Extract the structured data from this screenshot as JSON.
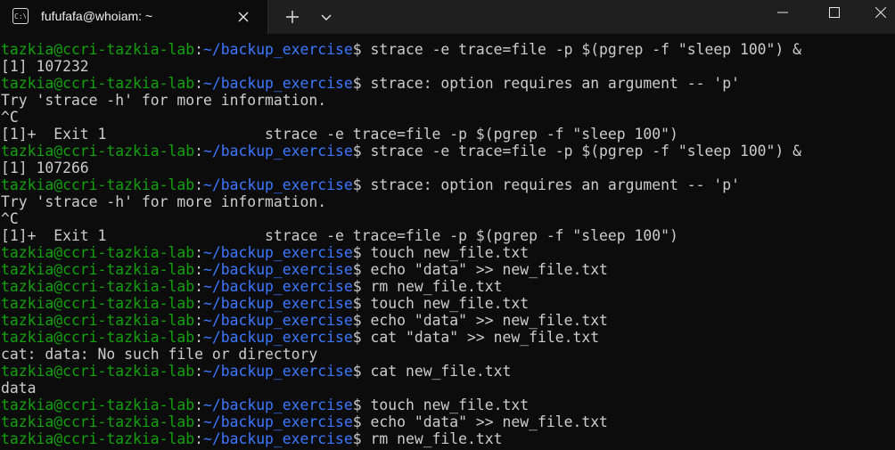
{
  "window": {
    "tab_title": "fufufafa@whoiam: ~",
    "icons": {
      "tab_icon": "terminal-icon",
      "close": "close-icon",
      "new_tab": "plus-icon",
      "dropdown": "chevron-down-icon",
      "minimize": "minimize-icon",
      "maximize": "maximize-icon",
      "close_window": "close-icon"
    }
  },
  "colors": {
    "background": "#0c0c0c",
    "prompt_user": "#13a10e",
    "prompt_path": "#3b78ff",
    "text": "#cccccc"
  },
  "terminal": {
    "prompt": {
      "user_host": "tazkia@ccri-tazkia-lab",
      "separator": ":",
      "path": "~/backup_exercise",
      "symbol": "$"
    },
    "lines": [
      {
        "type": "prompt",
        "cmd": " strace -e trace=file -p $(pgrep -f \"sleep 100\") &"
      },
      {
        "type": "output",
        "text": "[1] 107232"
      },
      {
        "type": "prompt",
        "cmd": " strace: option requires an argument -- 'p'"
      },
      {
        "type": "output",
        "text": "Try 'strace -h' for more information."
      },
      {
        "type": "output",
        "text": "^C"
      },
      {
        "type": "output",
        "text": "[1]+  Exit 1                  strace -e trace=file -p $(pgrep -f \"sleep 100\")"
      },
      {
        "type": "prompt",
        "cmd": " strace -e trace=file -p $(pgrep -f \"sleep 100\") &"
      },
      {
        "type": "output",
        "text": "[1] 107266"
      },
      {
        "type": "prompt",
        "cmd": " strace: option requires an argument -- 'p'"
      },
      {
        "type": "output",
        "text": "Try 'strace -h' for more information."
      },
      {
        "type": "output",
        "text": "^C"
      },
      {
        "type": "output",
        "text": "[1]+  Exit 1                  strace -e trace=file -p $(pgrep -f \"sleep 100\")"
      },
      {
        "type": "prompt",
        "cmd": " touch new_file.txt"
      },
      {
        "type": "prompt",
        "cmd": " echo \"data\" >> new_file.txt"
      },
      {
        "type": "prompt",
        "cmd": " rm new_file.txt"
      },
      {
        "type": "prompt",
        "cmd": " touch new_file.txt"
      },
      {
        "type": "prompt",
        "cmd": " echo \"data\" >> new_file.txt"
      },
      {
        "type": "prompt",
        "cmd": " cat \"data\" >> new_file.txt"
      },
      {
        "type": "output",
        "text": "cat: data: No such file or directory"
      },
      {
        "type": "prompt",
        "cmd": " cat new_file.txt"
      },
      {
        "type": "output",
        "text": "data"
      },
      {
        "type": "prompt",
        "cmd": " touch new_file.txt"
      },
      {
        "type": "prompt",
        "cmd": " echo \"data\" >> new_file.txt"
      },
      {
        "type": "prompt",
        "cmd": " rm new_file.txt"
      }
    ]
  }
}
